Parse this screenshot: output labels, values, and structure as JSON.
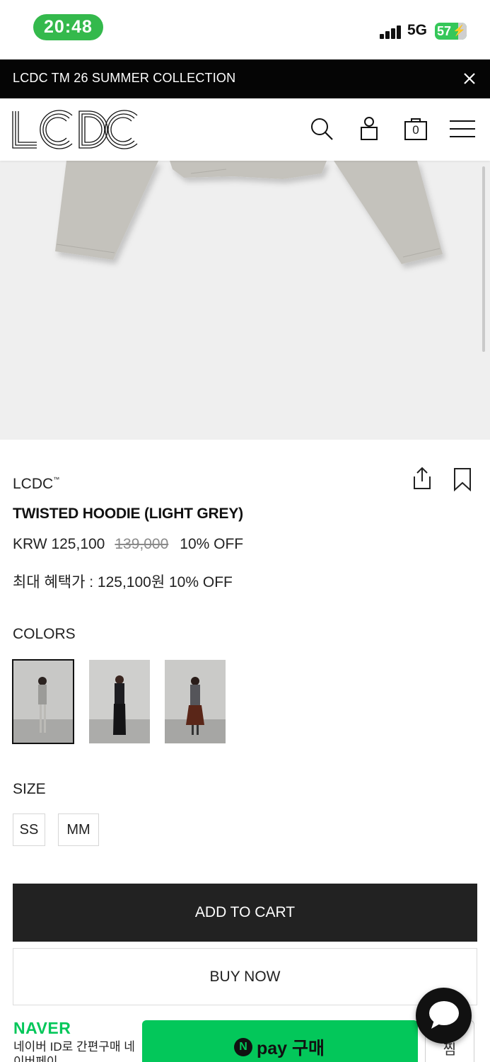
{
  "status_bar": {
    "time": "20:48",
    "network": "5G",
    "battery": "57",
    "time_pill_color": "#34b94c",
    "battery_color": "#35c759"
  },
  "banner": {
    "text": "LCDC TM 26 SUMMER COLLECTION",
    "close_icon": "close-icon"
  },
  "header": {
    "logo_text": "LCDC",
    "icons": [
      "search-icon",
      "user-icon",
      "cart-icon",
      "menu-icon"
    ],
    "cart_count": "0"
  },
  "product": {
    "brand": "LCDC",
    "brand_mark": "™",
    "name": "TWISTED HOODIE (LIGHT GREY)",
    "price": "KRW 125,100",
    "original_price": "139,000",
    "discount": "10% OFF",
    "max_benefit": "최대 혜택가 : 125,100원 10% OFF",
    "actions": [
      "share-icon",
      "bookmark-icon"
    ]
  },
  "colors": {
    "label": "COLORS",
    "swatches": [
      "light grey",
      "black",
      "charcoal"
    ],
    "selected_index": 0
  },
  "sizes": {
    "label": "SIZE",
    "options": [
      "SS",
      "MM"
    ]
  },
  "buttons": {
    "add_to_cart": "ADD TO CART",
    "buy_now": "BUY NOW"
  },
  "naver": {
    "logo": "NAVER",
    "description": "네이버 ID로 간편구매 네이버페이",
    "pay_label": "pay 구매",
    "pay_n": "N",
    "wish_label": "찜",
    "brand_color": "#03c75a"
  },
  "chat": {
    "icon": "chat-bubble-icon"
  }
}
